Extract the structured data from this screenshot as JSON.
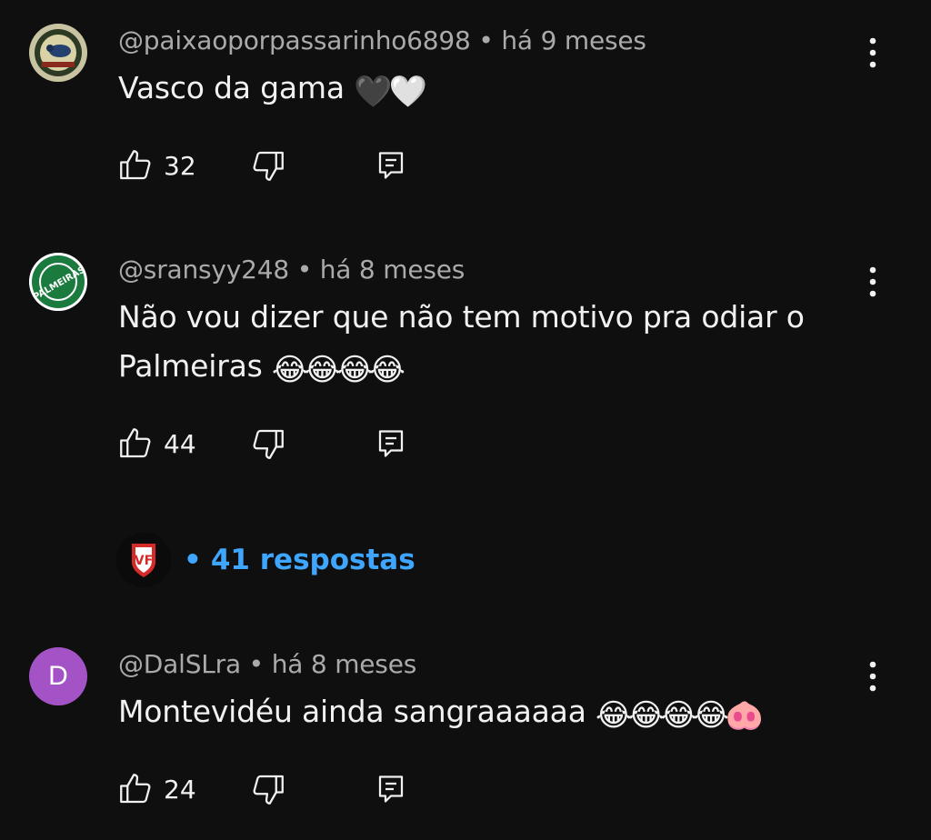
{
  "comments": [
    {
      "handle": "@paixaoporpassarinho6898",
      "time": "há 9 meses",
      "text": "Vasco da gama",
      "emoji": "🖤🤍",
      "likes": "32",
      "avatar_icon": "bird-crest-avatar-icon"
    },
    {
      "handle": "@sransyy248",
      "time": "há 8 meses",
      "text_line1": "Não vou dizer que não tem motivo pra odiar o",
      "text_line2": "Palmeiras",
      "emoji": "😂😂😂😂",
      "likes": "44",
      "avatar_text": "PALMEIRAS",
      "avatar_color": "#1b7a3e"
    },
    {
      "handle": "@DalSLra",
      "time": "há 8 meses",
      "text": "Montevidéu ainda sangraaaaaa",
      "emoji": "😂😂😂😂🐽",
      "likes": "24",
      "avatar_letter": "D",
      "avatar_color": "#a453c7"
    }
  ],
  "replies": {
    "label": "41 respostas",
    "bullet": "•",
    "avatar_text": "VF",
    "color": "#3ea6ff"
  },
  "separator": "•"
}
